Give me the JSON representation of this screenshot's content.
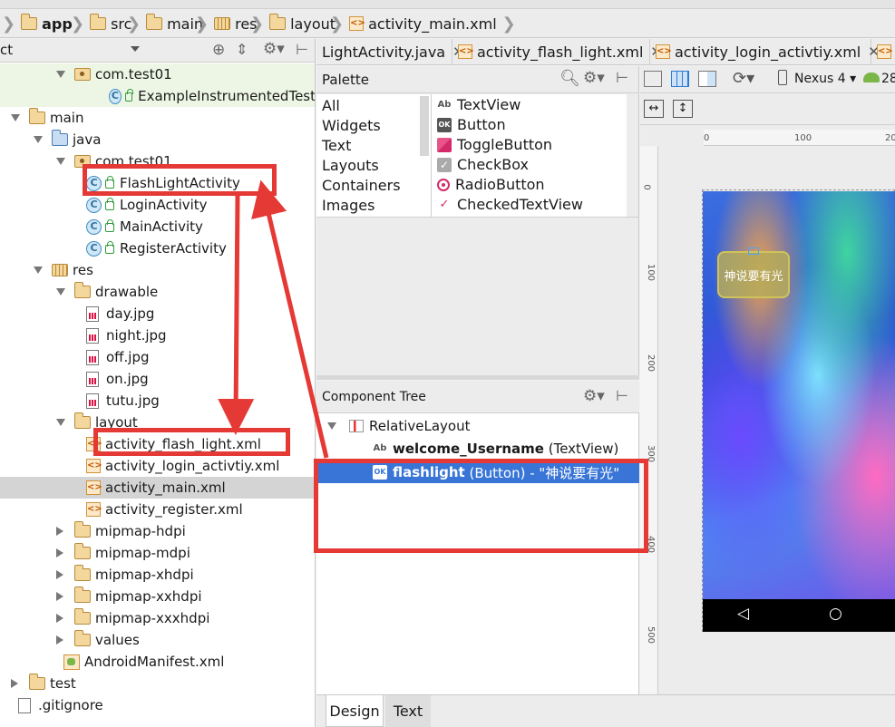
{
  "breadcrumb": [
    "app",
    "src",
    "main",
    "res",
    "layout",
    "activity_main.xml"
  ],
  "project_panel": {
    "header_label": "ct",
    "tree": [
      {
        "label": "com.test01",
        "kind": "pkg",
        "indent": 2,
        "expand": "down",
        "style": "green"
      },
      {
        "label": "ExampleInstrumentedTest",
        "kind": "class",
        "indent": 4,
        "expand": "none",
        "style": "green"
      },
      {
        "label": "main",
        "kind": "folder",
        "indent": 0,
        "expand": "down"
      },
      {
        "label": "java",
        "kind": "bluefolder",
        "indent": 1,
        "expand": "down"
      },
      {
        "label": "com.test01",
        "kind": "pkg",
        "indent": 2,
        "expand": "down"
      },
      {
        "label": "FlashLightActivity",
        "kind": "class",
        "indent": 3,
        "expand": "none"
      },
      {
        "label": "LoginActivity",
        "kind": "class",
        "indent": 3,
        "expand": "none"
      },
      {
        "label": "MainActivity",
        "kind": "class",
        "indent": 3,
        "expand": "none"
      },
      {
        "label": "RegisterActivity",
        "kind": "class",
        "indent": 3,
        "expand": "none"
      },
      {
        "label": "res",
        "kind": "res",
        "indent": 1,
        "expand": "down"
      },
      {
        "label": "drawable",
        "kind": "folder",
        "indent": 2,
        "expand": "down"
      },
      {
        "label": "day.jpg",
        "kind": "img",
        "indent": 3,
        "expand": "none"
      },
      {
        "label": "night.jpg",
        "kind": "img",
        "indent": 3,
        "expand": "none"
      },
      {
        "label": "off.jpg",
        "kind": "img",
        "indent": 3,
        "expand": "none"
      },
      {
        "label": "on.jpg",
        "kind": "img",
        "indent": 3,
        "expand": "none"
      },
      {
        "label": "tutu.jpg",
        "kind": "img",
        "indent": 3,
        "expand": "none"
      },
      {
        "label": "layout",
        "kind": "folder",
        "indent": 2,
        "expand": "down"
      },
      {
        "label": "activity_flash_light.xml",
        "kind": "xml",
        "indent": 3,
        "expand": "none"
      },
      {
        "label": "activity_login_activtiy.xml",
        "kind": "xml",
        "indent": 3,
        "expand": "none"
      },
      {
        "label": "activity_main.xml",
        "kind": "xml",
        "indent": 3,
        "expand": "none",
        "style": "sel"
      },
      {
        "label": "activity_register.xml",
        "kind": "xml",
        "indent": 3,
        "expand": "none"
      },
      {
        "label": "mipmap-hdpi",
        "kind": "folder",
        "indent": 2,
        "expand": "right"
      },
      {
        "label": "mipmap-mdpi",
        "kind": "folder",
        "indent": 2,
        "expand": "right"
      },
      {
        "label": "mipmap-xhdpi",
        "kind": "folder",
        "indent": 2,
        "expand": "right"
      },
      {
        "label": "mipmap-xxhdpi",
        "kind": "folder",
        "indent": 2,
        "expand": "right"
      },
      {
        "label": "mipmap-xxxhdpi",
        "kind": "folder",
        "indent": 2,
        "expand": "right"
      },
      {
        "label": "values",
        "kind": "folder",
        "indent": 2,
        "expand": "right"
      },
      {
        "label": "AndroidManifest.xml",
        "kind": "manifest",
        "indent": 2,
        "expand": "none"
      },
      {
        "label": "test",
        "kind": "folder",
        "indent": 0,
        "expand": "right"
      },
      {
        "label": ".gitignore",
        "kind": "file",
        "indent": 0,
        "expand": "none"
      }
    ]
  },
  "editor_tabs": [
    {
      "label": "LightActivity.java",
      "icon": "java"
    },
    {
      "label": "activity_flash_light.xml",
      "icon": "xml"
    },
    {
      "label": "activity_login_activtiy.xml",
      "icon": "xml"
    }
  ],
  "palette": {
    "title": "Palette",
    "categories": [
      "All",
      "Widgets",
      "Text",
      "Layouts",
      "Containers",
      "Images"
    ],
    "widgets": [
      {
        "label": "TextView",
        "icon": "Ab"
      },
      {
        "label": "Button",
        "icon": "OK"
      },
      {
        "label": "ToggleButton",
        "icon": "toggle"
      },
      {
        "label": "CheckBox",
        "icon": "check"
      },
      {
        "label": "RadioButton",
        "icon": "radio"
      },
      {
        "label": "CheckedTextView",
        "icon": "checked-text"
      }
    ]
  },
  "component_tree": {
    "title": "Component Tree",
    "root": "RelativeLayout",
    "children": [
      {
        "id": "welcome_Username",
        "type": "(TextView)",
        "icon": "Ab"
      },
      {
        "id": "flashlight",
        "type": "(Button) - \"神说要有光\"",
        "icon": "OK"
      }
    ]
  },
  "canvas": {
    "device": "Nexus 4",
    "api": "28",
    "ruler_h": [
      "0",
      "100",
      "20"
    ],
    "ruler_v": [
      "0",
      "100",
      "200",
      "300",
      "400",
      "500"
    ],
    "button_text": "神说要有光"
  },
  "bottom_tabs": [
    "Design",
    "Text"
  ]
}
